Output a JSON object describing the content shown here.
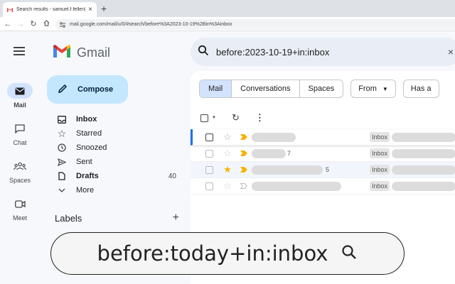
{
  "browser": {
    "tab_title": "Search results - samuel.f.feller@",
    "tab_close": "×",
    "new_tab": "+",
    "url": "mail.google.com/mail/u/0/#search/before%3A2023-10-19%2Bin%3Ainbox"
  },
  "app": {
    "logo_text": "Gmail"
  },
  "rail": {
    "items": [
      {
        "label": "Mail",
        "icon": "mail-icon"
      },
      {
        "label": "Chat",
        "icon": "chat-icon"
      },
      {
        "label": "Spaces",
        "icon": "spaces-icon"
      },
      {
        "label": "Meet",
        "icon": "meet-icon"
      }
    ]
  },
  "search": {
    "query": "before:2023-10-19+in:inbox",
    "clear": "×"
  },
  "compose": {
    "label": "Compose"
  },
  "folders": [
    {
      "label": "Inbox",
      "bold": true,
      "count": ""
    },
    {
      "label": "Starred",
      "bold": false,
      "count": ""
    },
    {
      "label": "Snoozed",
      "bold": false,
      "count": ""
    },
    {
      "label": "Sent",
      "bold": false,
      "count": ""
    },
    {
      "label": "Drafts",
      "bold": true,
      "count": "40"
    },
    {
      "label": "More",
      "bold": false,
      "count": ""
    }
  ],
  "labels": {
    "title": "Labels",
    "add": "+"
  },
  "filters": {
    "segments": [
      "Mail",
      "Conversations",
      "Spaces"
    ],
    "from": "From",
    "has": "Has a"
  },
  "emails": [
    {
      "count": "",
      "tag": "Inbox",
      "starred": false
    },
    {
      "count": "7",
      "tag": "Inbox",
      "starred": false
    },
    {
      "count": "5",
      "tag": "Inbox",
      "starred": true
    },
    {
      "count": "",
      "tag": "Inbox",
      "starred": false
    }
  ],
  "overlay": {
    "text": "before:today+in:inbox"
  },
  "colors": {
    "accent": "#1a73e8",
    "compose_bg": "#c2e7ff",
    "star": "#f4b400",
    "important": "#f4b400"
  }
}
